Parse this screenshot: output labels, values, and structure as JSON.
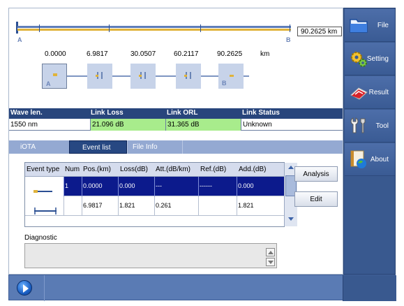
{
  "trace": {
    "length_readout": "90.2625 km",
    "start_label": "A",
    "end_label": "B"
  },
  "events_map": {
    "distances": [
      "0.0000",
      "6.9817",
      "30.0507",
      "60.2117",
      "90.2625"
    ],
    "unit": "km",
    "marker_a": "A",
    "marker_b": "B"
  },
  "summary": {
    "headers": [
      "Wave len.",
      "Link Loss",
      "Link ORL",
      "Link Status"
    ],
    "values": [
      "1550 nm",
      "21.096 dB",
      "31.365 dB",
      "Unknown"
    ],
    "pass_color": "#a8ec8c"
  },
  "tabs": [
    "iOTA",
    "Event list",
    "File Info"
  ],
  "active_tab": "Event list",
  "event_table": {
    "headers": [
      "Event type",
      "Num",
      "Pos.(km)",
      "Loss(dB)",
      "Att.(dB/km)",
      "Ref.(dB)",
      "Add.(dB)"
    ],
    "rows": [
      {
        "num": "1",
        "pos": "0.0000",
        "loss": "0.000",
        "att": "---",
        "ref": "------",
        "add": "0.000"
      },
      {
        "num": "",
        "pos": "6.9817",
        "loss": "1.821",
        "att": "0.261",
        "ref": "",
        "add": "1.821"
      }
    ],
    "selected_row_color": "#0c1a8c"
  },
  "buttons": {
    "analysis": "Analysis",
    "edit": "Edit"
  },
  "diagnostic": {
    "label": "Diagnostic",
    "text": ""
  },
  "menu": [
    {
      "label": "File",
      "icon": "folder-icon"
    },
    {
      "label": "Setting",
      "icon": "gears-icon"
    },
    {
      "label": "Result",
      "icon": "result-icon"
    },
    {
      "label": "Tool",
      "icon": "wrench-icon"
    },
    {
      "label": "About",
      "icon": "about-icon"
    }
  ],
  "colors": {
    "header_blue": "#28457c",
    "sidebar_blue": "#39598f",
    "fiber_yellow": "#e0b33a"
  }
}
